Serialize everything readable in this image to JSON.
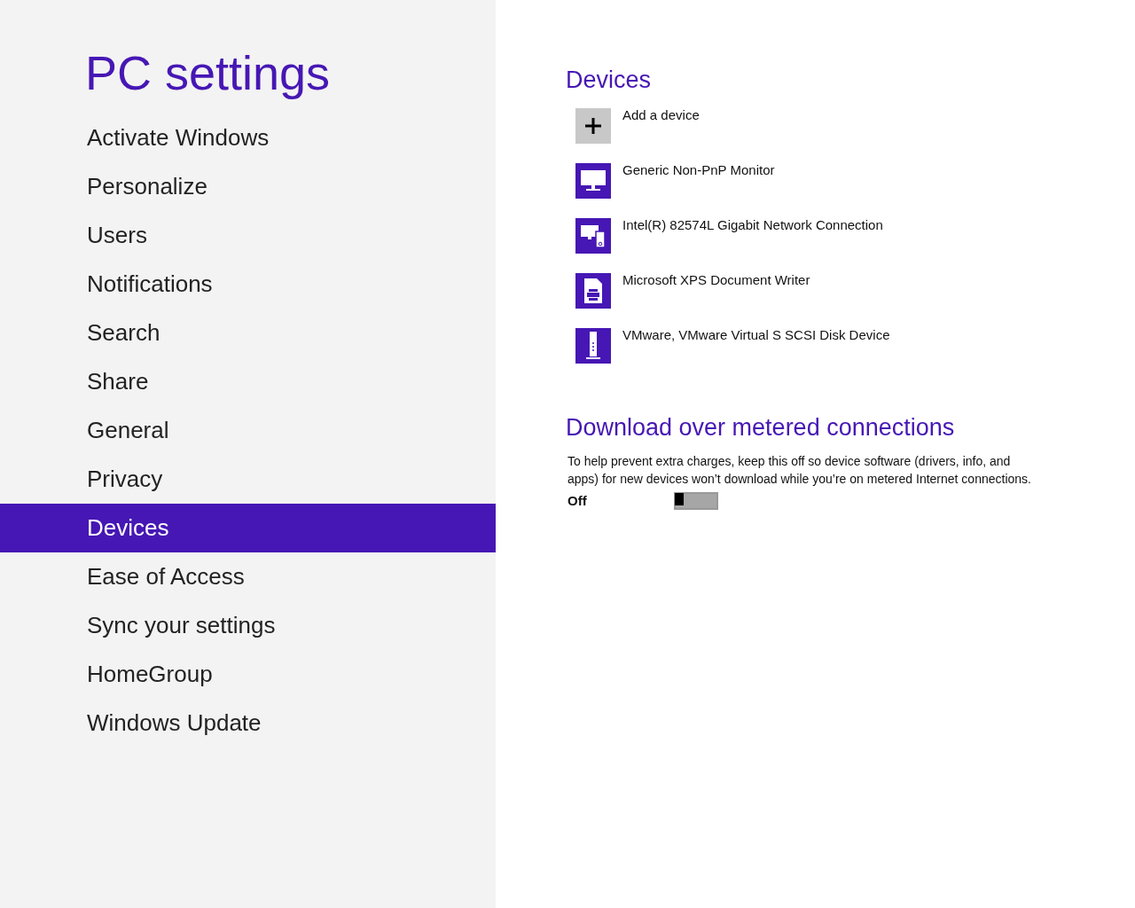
{
  "sidebar": {
    "title": "PC settings",
    "items": [
      {
        "label": "Activate Windows",
        "selected": false
      },
      {
        "label": "Personalize",
        "selected": false
      },
      {
        "label": "Users",
        "selected": false
      },
      {
        "label": "Notifications",
        "selected": false
      },
      {
        "label": "Search",
        "selected": false
      },
      {
        "label": "Share",
        "selected": false
      },
      {
        "label": "General",
        "selected": false
      },
      {
        "label": "Privacy",
        "selected": false
      },
      {
        "label": "Devices",
        "selected": true
      },
      {
        "label": "Ease of Access",
        "selected": false
      },
      {
        "label": "Sync your settings",
        "selected": false
      },
      {
        "label": "HomeGroup",
        "selected": false
      },
      {
        "label": "Windows Update",
        "selected": false
      }
    ]
  },
  "devices": {
    "heading": "Devices",
    "items": [
      {
        "kind": "add",
        "name": "Add a device"
      },
      {
        "kind": "monitor",
        "name": "Generic Non-PnP Monitor"
      },
      {
        "kind": "network",
        "name": "Intel(R) 82574L Gigabit Network Connection"
      },
      {
        "kind": "printer",
        "name": "Microsoft XPS Document Writer"
      },
      {
        "kind": "disk",
        "name": "VMware, VMware Virtual S SCSI Disk Device"
      }
    ]
  },
  "metered": {
    "heading": "Download over metered connections",
    "description": "To help prevent extra charges, keep this off so device software (drivers, info, and apps) for new devices won’t download while you’re on metered Internet connections.",
    "toggle": {
      "label": "Off",
      "on": false
    }
  }
}
